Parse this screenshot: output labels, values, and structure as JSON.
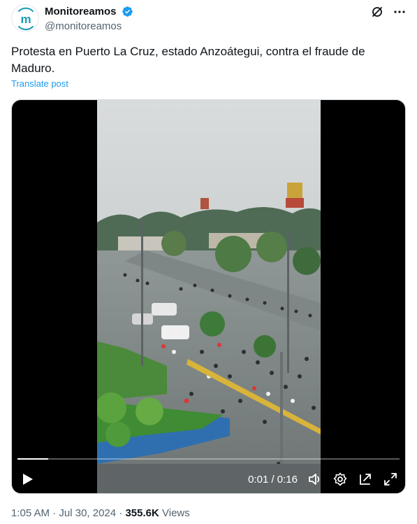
{
  "author": {
    "display_name": "Monitoreamos",
    "handle": "@monitoreamos",
    "avatar_letter": "m",
    "verified": true,
    "brand_color": "#1a9bb5"
  },
  "header_icons": [
    "grok-icon",
    "more-icon"
  ],
  "tweet": {
    "text": "Protesta en Puerto La Cruz, estado Anzoátegui, contra el fraude de Maduro.",
    "translate_label": "Translate post"
  },
  "video": {
    "time_display": "0:01 / 0:16",
    "progress_fraction": 0.08,
    "controls": [
      "play-icon",
      "volume-icon",
      "settings-icon",
      "pop-out-icon",
      "fullscreen-icon"
    ]
  },
  "meta": {
    "time": "1:05 AM",
    "sep1": " · ",
    "date": "Jul 30, 2024",
    "sep2": " · ",
    "views_count": "355.6K",
    "views_label": " Views"
  },
  "colors": {
    "link": "#1d9bf0",
    "muted": "#536471",
    "text": "#0f1419"
  }
}
